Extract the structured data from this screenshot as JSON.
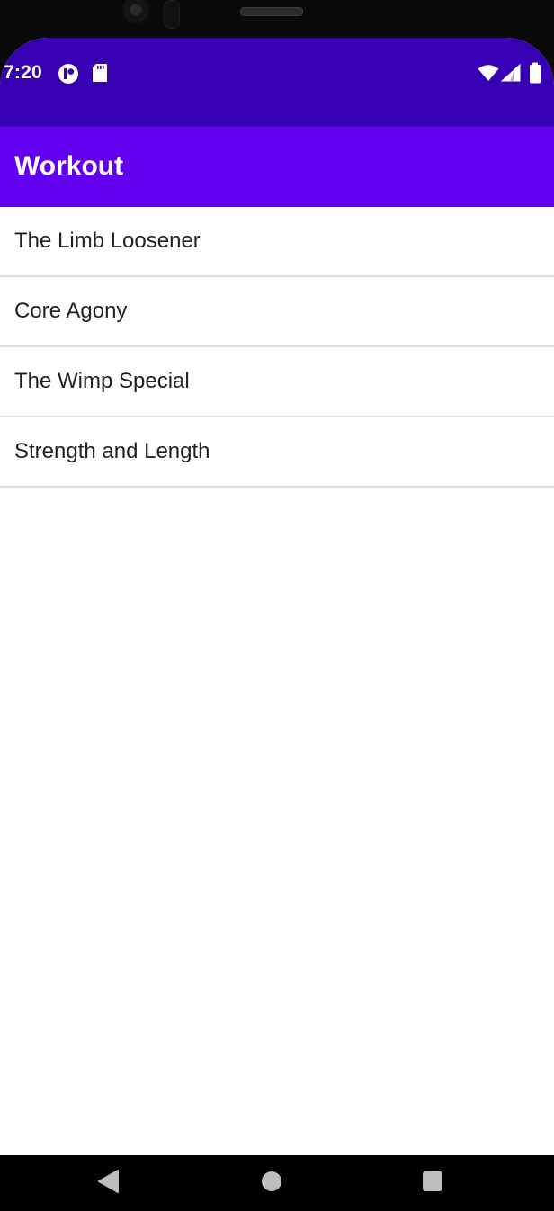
{
  "status_bar": {
    "time": "7:20",
    "icons": [
      "app-notification-icon",
      "sd-card-icon",
      "wifi-icon",
      "cell-signal-icon",
      "battery-icon"
    ]
  },
  "app_bar": {
    "title": "Workout"
  },
  "workouts": [
    {
      "label": "The Limb Loosener"
    },
    {
      "label": "Core Agony"
    },
    {
      "label": "The Wimp Special"
    },
    {
      "label": "Strength and Length"
    }
  ],
  "nav_bar": {
    "icons": [
      "back-icon",
      "home-icon",
      "recents-icon"
    ]
  },
  "colors": {
    "status_bar": "#3700b3",
    "app_bar": "#6200ee",
    "list_text": "#212121",
    "divider": "#dcdcdc"
  }
}
